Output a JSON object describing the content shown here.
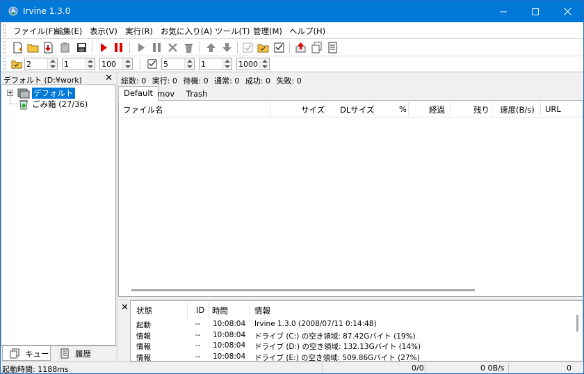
{
  "window": {
    "title": "Irvine 1.3.0"
  },
  "menu": [
    "ファイル(F)",
    "編集(E)",
    "表示(V)",
    "実行(R)",
    "お気に入り(A)",
    "ツール(T)",
    "管理(M)",
    "ヘルプ(H)"
  ],
  "spinners": {
    "s1": "2",
    "s2": "1",
    "s3": "100",
    "s4": "5",
    "s5": "1",
    "s6": "1000"
  },
  "left_panel": {
    "title": "デフォルト (D:¥work)",
    "tree": [
      {
        "label": "デフォルト"
      },
      {
        "label": "ごみ箱 (27/36)"
      }
    ],
    "tabs": [
      {
        "label": "キュー"
      },
      {
        "label": "履歴"
      }
    ]
  },
  "stats": {
    "total": "総数: 0",
    "running": "実行: 0",
    "waiting": "待機: 0",
    "normal": "通常: 0",
    "success": "成功: 0",
    "failed": "失敗: 0"
  },
  "queue_tabs": [
    "Default",
    "mov",
    "Trash"
  ],
  "list_columns": [
    "ファイル名",
    "サイズ",
    "DLサイズ",
    "%",
    "経過",
    "残り",
    "速度(B/s)",
    "URL"
  ],
  "log": {
    "columns": [
      "状態",
      "ID",
      "時間",
      "情報"
    ],
    "rows": [
      {
        "state": "起動",
        "id": "--",
        "time": "10:08:04",
        "info": "Irvine 1.3.0 (2008/07/11 0:14:48)"
      },
      {
        "state": "情報",
        "id": "--",
        "time": "10:08:04",
        "info": "ドライブ (C:) の空き領域: 87.42Gバイト (19%)"
      },
      {
        "state": "情報",
        "id": "--",
        "time": "10:08:04",
        "info": "ドライブ (D:) の空き領域: 132.13Gバイト (14%)"
      },
      {
        "state": "情報",
        "id": "--",
        "time": "10:08:04",
        "info": "ドライブ (E:) の空き領域: 509.86Gバイト (27%)"
      }
    ]
  },
  "statusbar": {
    "startup": "起動時間: 1188ms",
    "count": "0/0",
    "speed": "0 0B/s",
    "last": "0"
  }
}
